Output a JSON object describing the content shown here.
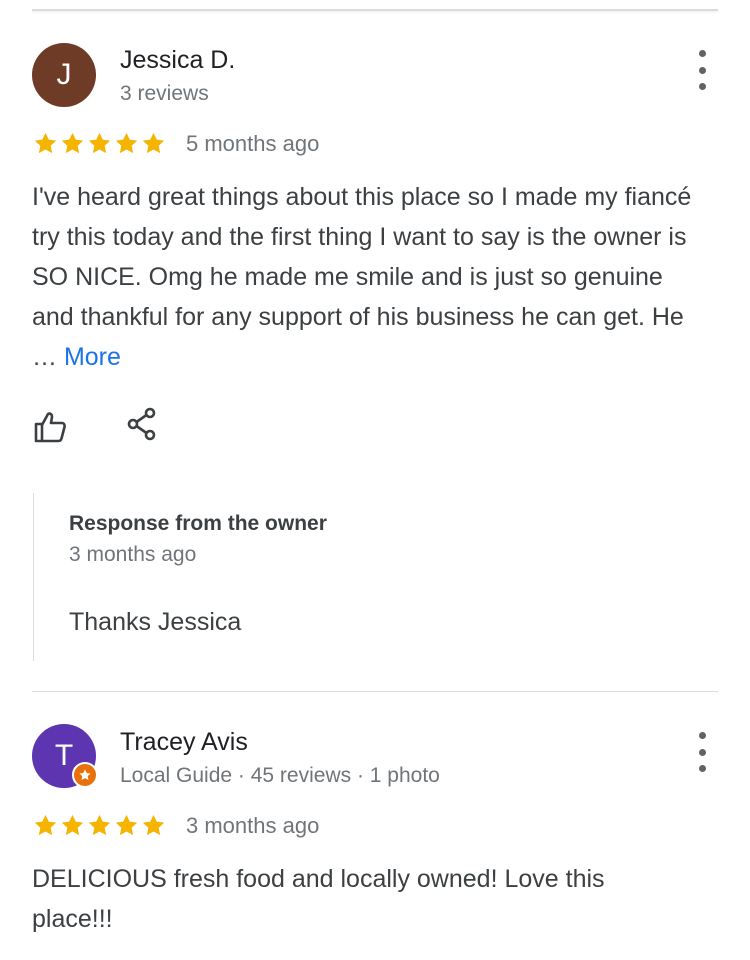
{
  "reviews": [
    {
      "avatar_letter": "J",
      "avatar_color": "#6d3b26",
      "name": "Jessica D.",
      "meta": "3 reviews",
      "rating": 5,
      "time": "5 months ago",
      "text": "I've heard great things about this place so I made my fiancé try this today and the first thing I want to say is the owner is SO NICE. Omg he made me smile and is just so genuine and thankful for any support of his business he can get. He … ",
      "more_label": "More",
      "owner_response": {
        "title": "Response from the owner",
        "time": "3 months ago",
        "text": "Thanks Jessica"
      }
    },
    {
      "avatar_letter": "T",
      "avatar_color": "#5e35b1",
      "name": "Tracey Avis",
      "meta": "Local Guide · 45 reviews · 1 photo",
      "rating": 5,
      "time": "3 months ago",
      "text": "DELICIOUS fresh food and locally owned! Love this place!!!"
    }
  ],
  "colors": {
    "star": "#f4b400",
    "link": "#1a73e8",
    "local_guide_badge": "#e8710a"
  },
  "icons": [
    "thumbs-up-icon",
    "share-icon",
    "more-vert-icon",
    "star-icon",
    "local-guide-badge-icon"
  ]
}
